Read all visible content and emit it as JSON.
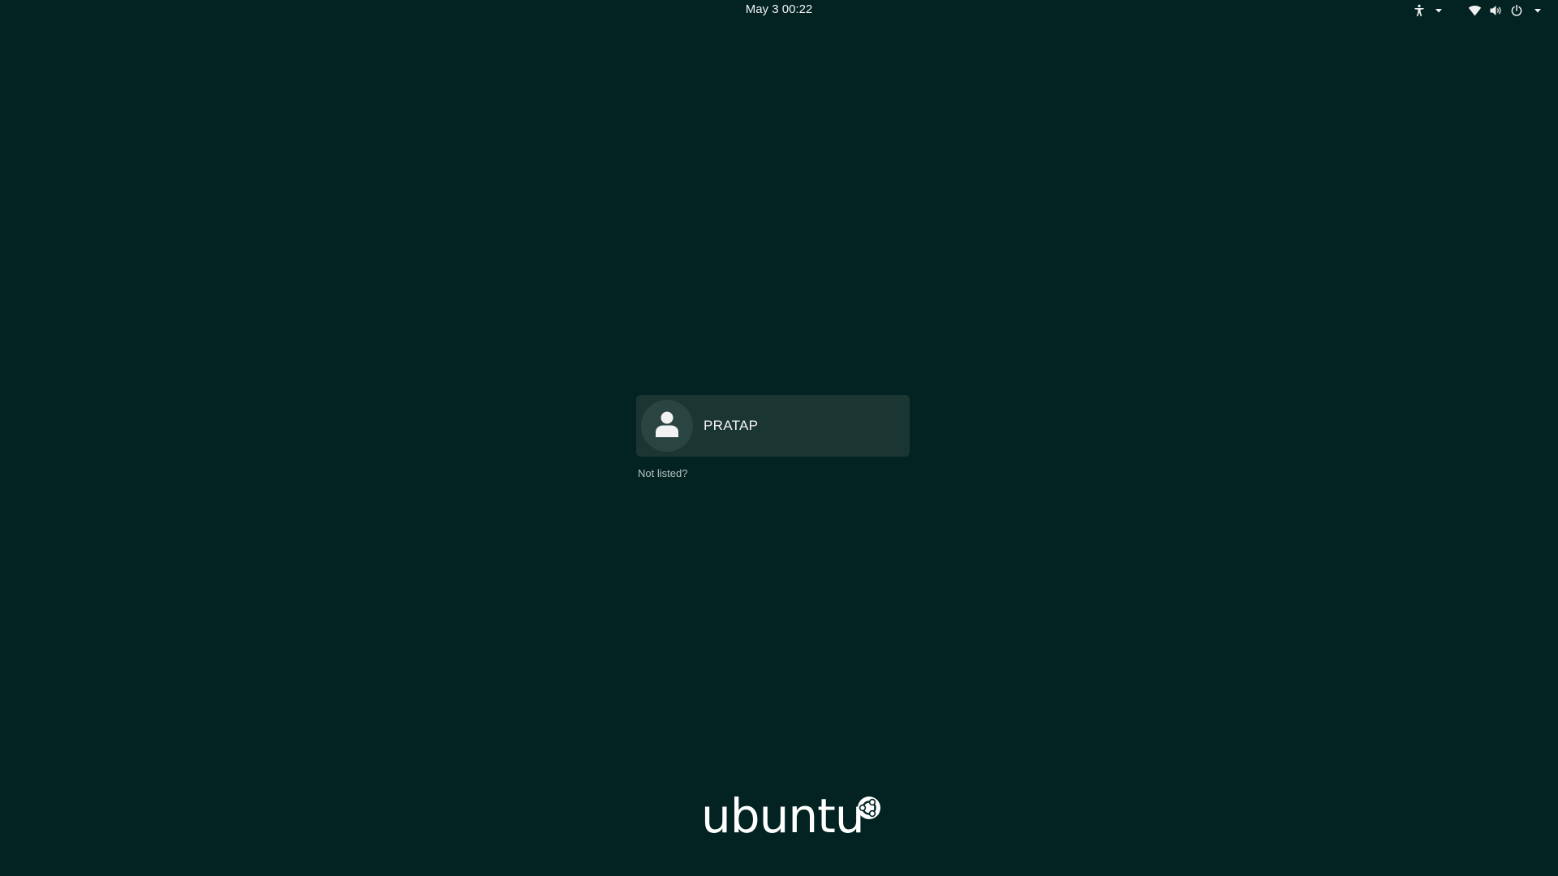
{
  "topbar": {
    "clock": "May 3  00:22",
    "icons": {
      "accessibility": "accessibility-icon",
      "accessibility_menu": "chevron-down-icon",
      "network": "wifi-icon",
      "volume": "speaker-icon",
      "power": "power-icon",
      "system_menu": "chevron-down-icon"
    }
  },
  "login": {
    "users": [
      {
        "name": "PRATAP",
        "avatar": "user-silhouette-icon"
      }
    ],
    "not_listed": "Not listed?"
  },
  "branding": {
    "logo_text": "ubuntu"
  },
  "colors": {
    "background": "#022322",
    "card": "#1b3533",
    "avatar_bg": "#2a4441",
    "text": "#f3f3f3",
    "muted_text": "#b8c2c0"
  }
}
